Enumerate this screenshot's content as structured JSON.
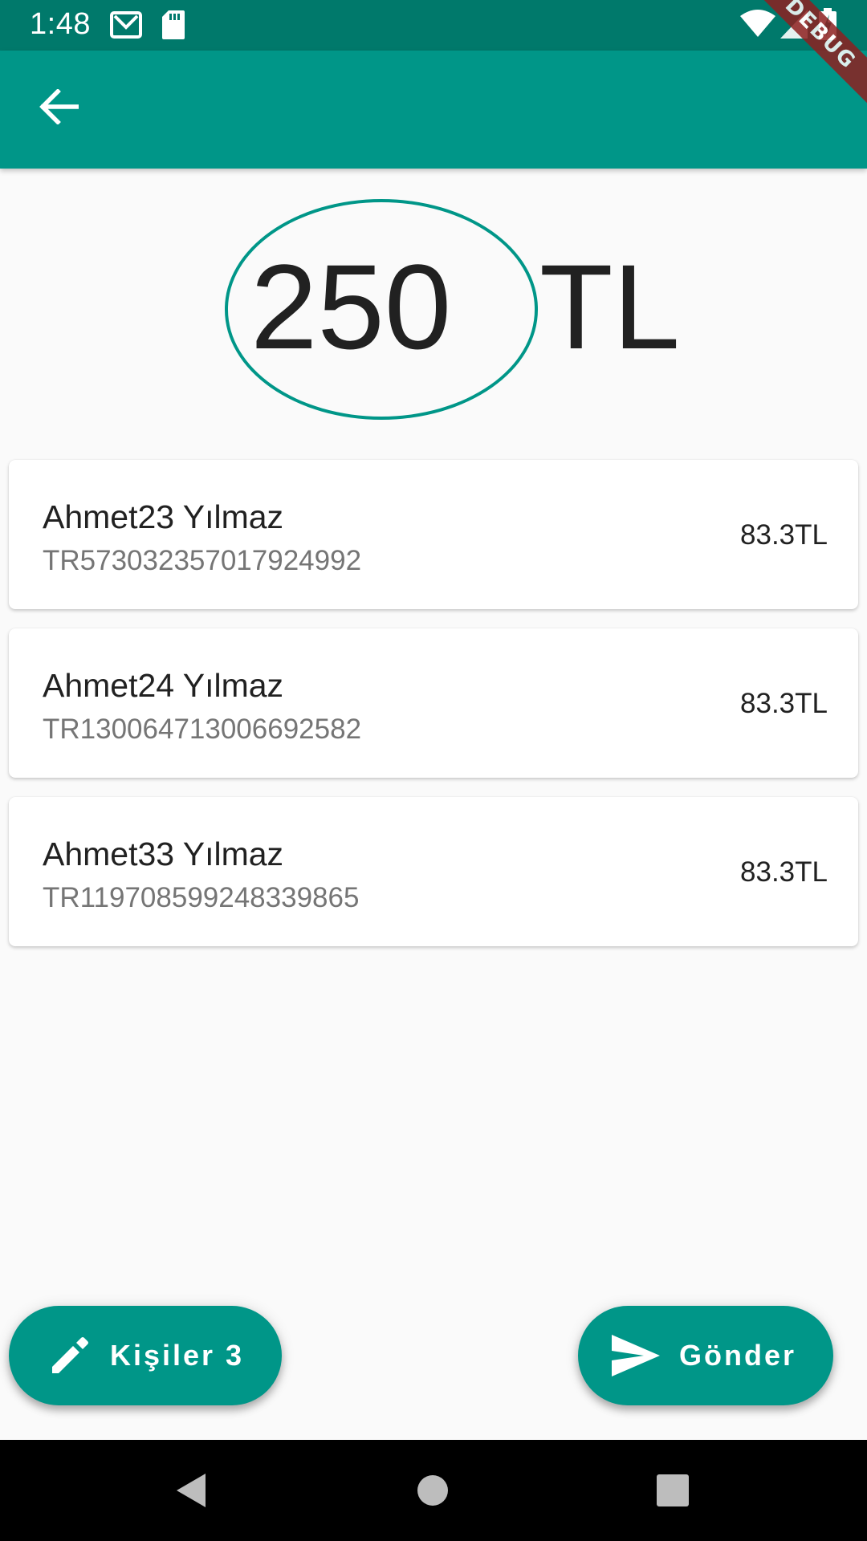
{
  "status_bar": {
    "time": "1:48",
    "icons": [
      "gmail-icon",
      "sd-card-icon",
      "wifi-icon",
      "signal-icon",
      "battery-charging-icon"
    ]
  },
  "debug_banner": "DEBUG",
  "app_bar": {
    "back_icon": "arrow-back-icon",
    "color": "#009688"
  },
  "amount": {
    "value": "250",
    "currency": "TL"
  },
  "recipients": [
    {
      "name": "Ahmet23 Yılmaz",
      "iban": "TR573032357017924992",
      "share": "83.3TL"
    },
    {
      "name": "Ahmet24 Yılmaz",
      "iban": "TR130064713006692582",
      "share": "83.3TL"
    },
    {
      "name": "Ahmet33 Yılmaz",
      "iban": "TR119708599248339865",
      "share": "83.3TL"
    }
  ],
  "actions": {
    "people_button": {
      "label": "Kişiler 3",
      "icon": "pencil-icon"
    },
    "send_button": {
      "label": "Gönder",
      "icon": "send-icon"
    }
  },
  "nav_bar": {
    "icons": [
      "back-triangle-icon",
      "home-circle-icon",
      "recents-square-icon"
    ]
  },
  "colors": {
    "primary": "#009688",
    "primary_dark": "#00796b",
    "background": "#fafafa"
  }
}
